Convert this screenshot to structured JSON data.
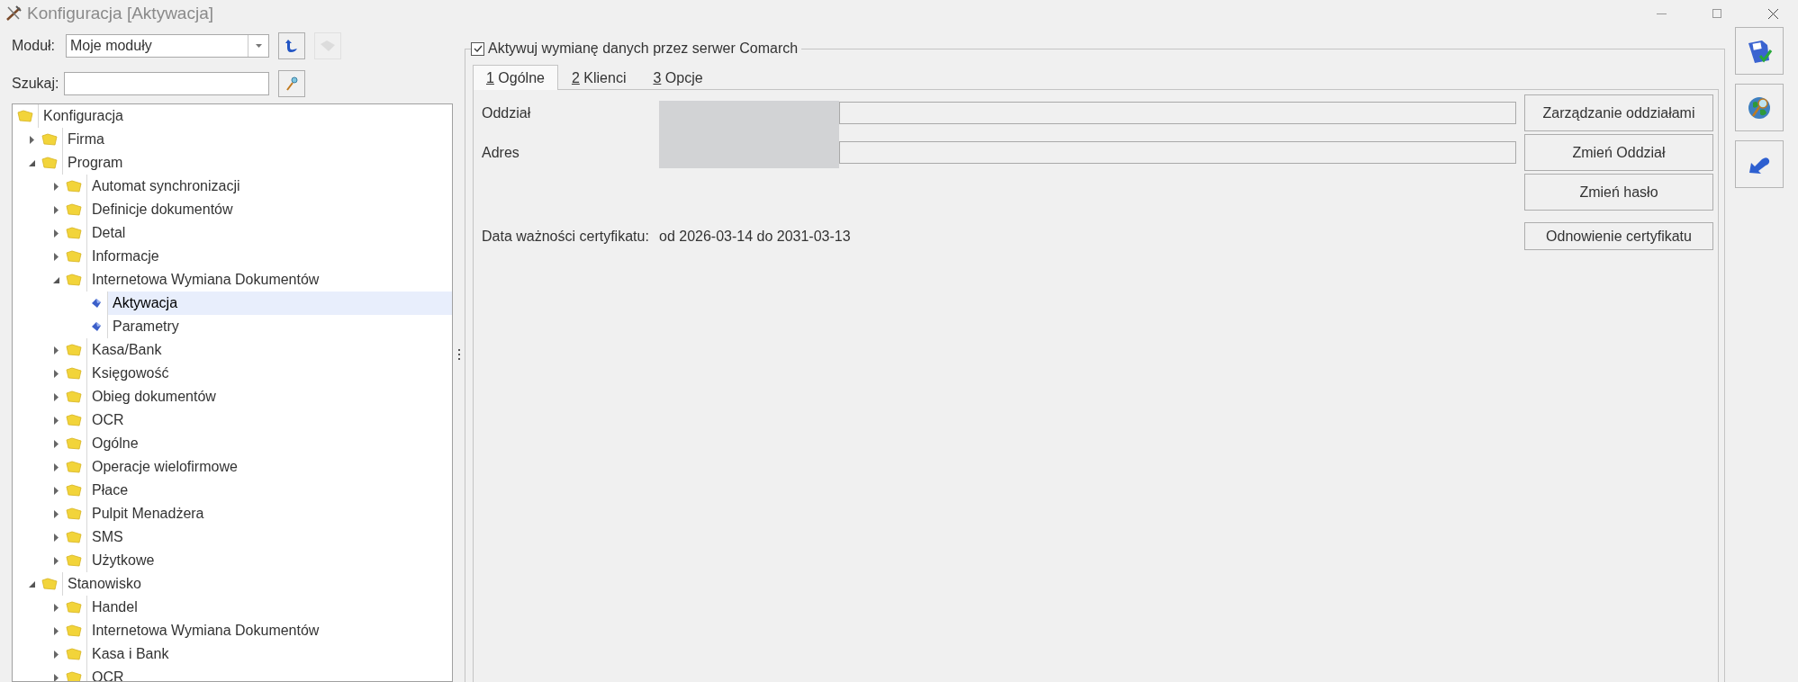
{
  "window": {
    "title": "Konfiguracja [Aktywacja]"
  },
  "module": {
    "label": "Moduł:",
    "value": "Moje moduły"
  },
  "module_buttons": [
    {
      "kind": "back",
      "disabled": false
    },
    {
      "kind": "clear",
      "disabled": true
    }
  ],
  "search": {
    "label": "Szukaj:"
  },
  "tree": [
    {
      "label": "Konfiguracja",
      "kind": "root",
      "selected": false,
      "children": [
        {
          "label": "Firma",
          "kind": "folder",
          "expanded": false,
          "selected": false
        },
        {
          "label": "Program",
          "kind": "folder",
          "expanded": true,
          "selected": false,
          "children": [
            {
              "label": "Automat synchronizacji",
              "kind": "folder",
              "expanded": false,
              "selected": false
            },
            {
              "label": "Definicje dokumentów",
              "kind": "folder",
              "expanded": false,
              "selected": false
            },
            {
              "label": "Detal",
              "kind": "folder",
              "expanded": false,
              "selected": false
            },
            {
              "label": "Informacje",
              "kind": "folder",
              "expanded": false,
              "selected": false
            },
            {
              "label": "Internetowa Wymiana Dokumentów",
              "kind": "folder",
              "expanded": true,
              "selected": false,
              "children": [
                {
                  "label": "Aktywacja",
                  "kind": "page",
                  "selected": true
                },
                {
                  "label": "Parametry",
                  "kind": "page",
                  "selected": false
                }
              ]
            },
            {
              "label": "Kasa/Bank",
              "kind": "folder",
              "expanded": false,
              "selected": false
            },
            {
              "label": "Księgowość",
              "kind": "folder",
              "expanded": false,
              "selected": false
            },
            {
              "label": "Obieg dokumentów",
              "kind": "folder",
              "expanded": false,
              "selected": false
            },
            {
              "label": "OCR",
              "kind": "folder",
              "expanded": false,
              "selected": false
            },
            {
              "label": "Ogólne",
              "kind": "folder",
              "expanded": false,
              "selected": false
            },
            {
              "label": "Operacje wielofirmowe",
              "kind": "folder",
              "expanded": false,
              "selected": false
            },
            {
              "label": "Płace",
              "kind": "folder",
              "expanded": false,
              "selected": false
            },
            {
              "label": "Pulpit Menadżera",
              "kind": "folder",
              "expanded": false,
              "selected": false
            },
            {
              "label": "SMS",
              "kind": "folder",
              "expanded": false,
              "selected": false
            },
            {
              "label": "Użytkowe",
              "kind": "folder",
              "expanded": false,
              "selected": false
            }
          ]
        },
        {
          "label": "Stanowisko",
          "kind": "folder",
          "expanded": true,
          "selected": false,
          "children": [
            {
              "label": "Handel",
              "kind": "folder",
              "expanded": false,
              "selected": false
            },
            {
              "label": "Internetowa Wymiana Dokumentów",
              "kind": "folder",
              "expanded": false,
              "selected": false
            },
            {
              "label": "Kasa i Bank",
              "kind": "folder",
              "expanded": false,
              "selected": false
            },
            {
              "label": "OCR",
              "kind": "folder",
              "expanded": false,
              "selected": false
            }
          ]
        }
      ]
    }
  ],
  "group": {
    "label": "Aktywuj wymianę danych przez serwer Comarch",
    "checked": true
  },
  "tabs": [
    {
      "hotkey": "1",
      "label": "Ogólne",
      "selected": true
    },
    {
      "hotkey": "2",
      "label": "Klienci",
      "selected": false
    },
    {
      "hotkey": "3",
      "label": "Opcje",
      "selected": false
    }
  ],
  "fields": [
    {
      "label": "Oddział"
    },
    {
      "label": "Adres"
    }
  ],
  "buttons": [
    "Zarządzanie oddziałami",
    "Zmień Oddział",
    "Zmień hasło",
    "Odnowienie certyfikatu"
  ],
  "certificate": {
    "label": "Data ważności certyfikatu:",
    "value": "od 2026-03-14 do 2031-03-13"
  }
}
